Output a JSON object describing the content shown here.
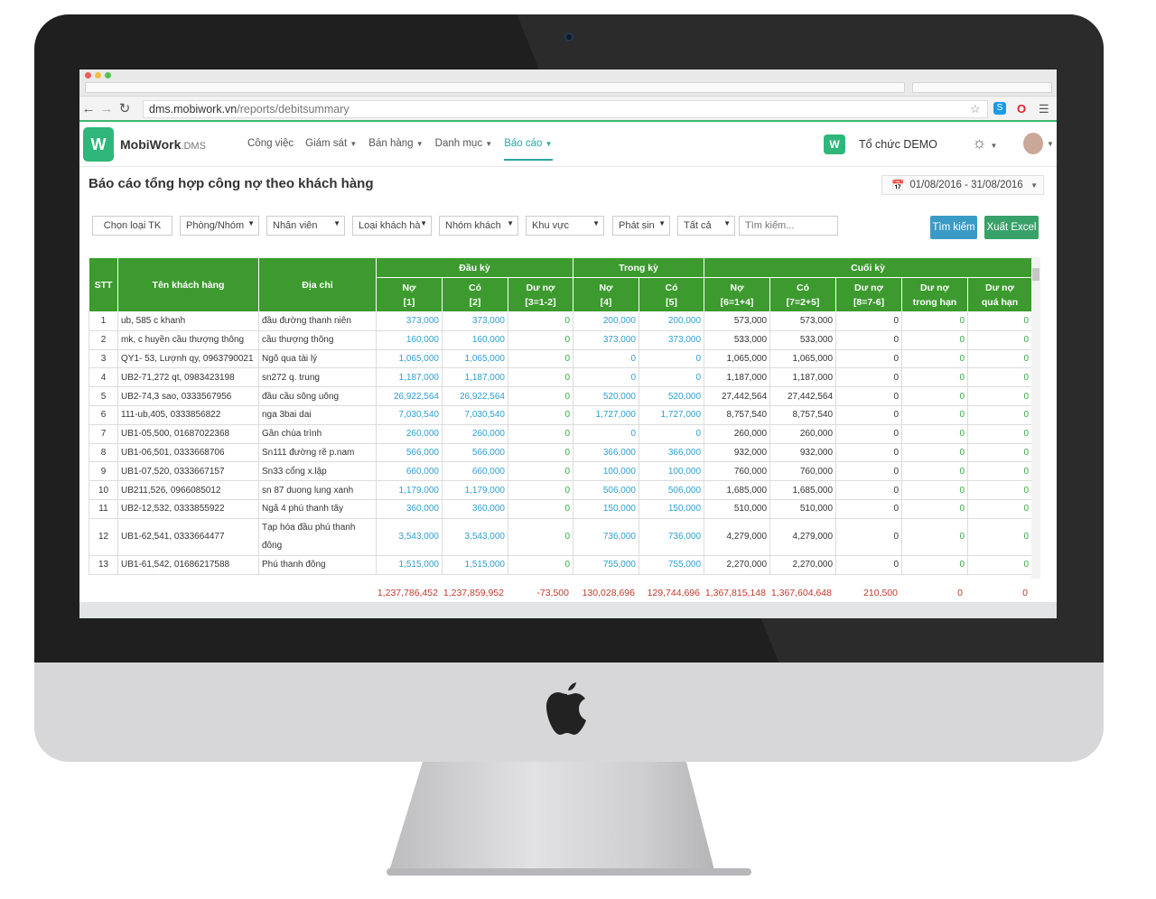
{
  "browser": {
    "url_host": "dms.mobiwork.vn",
    "url_path": "/reports/debitsummary"
  },
  "app": {
    "brand": "MobiWork",
    "brand_suffix": ".DMS",
    "logo_letter": "W",
    "menu": [
      "Công việc",
      "Giám sát",
      "Bán hàng",
      "Danh mục",
      "Báo cáo"
    ],
    "org_name": "Tổ chức DEMO"
  },
  "page": {
    "title": "Báo cáo tổng hợp công nợ theo khách hàng",
    "date_range": "01/08/2016 - 31/08/2016"
  },
  "filters": {
    "account_type": "Chọn loại TK",
    "department": "Phòng/Nhóm",
    "staff": "Nhân viên",
    "customer_type": "Loại khách hà",
    "customer_group": "Nhóm khách",
    "region": "Khu vực",
    "occurrence": "Phát sin",
    "status": "Tất cả",
    "search_placeholder": "Tìm kiếm...",
    "search_button": "Tìm kiếm",
    "export_button": "Xuất Excel"
  },
  "table": {
    "head": {
      "stt": "STT",
      "customer": "Tên khách hàng",
      "address": "Địa chỉ",
      "opening": "Đầu kỳ",
      "period": "Trong kỳ",
      "closing": "Cuối kỳ",
      "c1a": "Nợ",
      "c1b": "[1]",
      "c2a": "Có",
      "c2b": "[2]",
      "c3a": "Dư nợ",
      "c3b": "[3=1-2]",
      "c4a": "Nợ",
      "c4b": "[4]",
      "c5a": "Có",
      "c5b": "[5]",
      "c6a": "Nợ",
      "c6b": "[6=1+4]",
      "c7a": "Có",
      "c7b": "[7=2+5]",
      "c8a": "Dư nợ",
      "c8b": "[8=7-6]",
      "c9a": "Dư nợ",
      "c9b": "trong hạn",
      "c10a": "Dư nợ",
      "c10b": "quá hạn"
    },
    "rows": [
      [
        "1",
        "ub, 585 c khanh",
        "đầu đường thanh niên",
        "373,000",
        "373,000",
        "0",
        "200,000",
        "200,000",
        "573,000",
        "573,000",
        "0",
        "0",
        "0"
      ],
      [
        "2",
        "mk, c huyền cầu thượng thông",
        "cầu thượng thông",
        "160,000",
        "160,000",
        "0",
        "373,000",
        "373,000",
        "533,000",
        "533,000",
        "0",
        "0",
        "0"
      ],
      [
        "3",
        "QY1- 53, Lượnh qy, 0963790021",
        "Ngõ qua tài lý",
        "1,065,000",
        "1,065,000",
        "0",
        "0",
        "0",
        "1,065,000",
        "1,065,000",
        "0",
        "0",
        "0"
      ],
      [
        "4",
        "UB2-71,272 qt, 0983423198",
        "sn272 q. trung",
        "1,187,000",
        "1,187,000",
        "0",
        "0",
        "0",
        "1,187,000",
        "1,187,000",
        "0",
        "0",
        "0"
      ],
      [
        "5",
        "UB2-74,3 sao, 0333567956",
        "đầu cầu sông uông",
        "26,922,564",
        "26,922,564",
        "0",
        "520,000",
        "520,000",
        "27,442,564",
        "27,442,564",
        "0",
        "0",
        "0"
      ],
      [
        "6",
        "111-ub,405, 0333856822",
        "nga 3bai dai",
        "7,030,540",
        "7,030,540",
        "0",
        "1,727,000",
        "1,727,000",
        "8,757,540",
        "8,757,540",
        "0",
        "0",
        "0"
      ],
      [
        "7",
        "UB1-05,500, 01687022368",
        "Gần chùa trình",
        "260,000",
        "260,000",
        "0",
        "0",
        "0",
        "260,000",
        "260,000",
        "0",
        "0",
        "0"
      ],
      [
        "8",
        "UB1-06,501, 0333668706",
        "Sn111 đường rẽ p.nam",
        "566,000",
        "566,000",
        "0",
        "366,000",
        "366,000",
        "932,000",
        "932,000",
        "0",
        "0",
        "0"
      ],
      [
        "9",
        "UB1-07,520, 0333667157",
        "Sn33 cổng x.lập",
        "660,000",
        "660,000",
        "0",
        "100,000",
        "100,000",
        "760,000",
        "760,000",
        "0",
        "0",
        "0"
      ],
      [
        "10",
        "UB211,526, 0966085012",
        "sn 87 duong lung xanh",
        "1,179,000",
        "1,179,000",
        "0",
        "506,000",
        "506,000",
        "1,685,000",
        "1,685,000",
        "0",
        "0",
        "0"
      ],
      [
        "11",
        "UB2-12,532, 0333855922",
        "Ngã 4 phú thanh tây",
        "360,000",
        "360,000",
        "0",
        "150,000",
        "150,000",
        "510,000",
        "510,000",
        "0",
        "0",
        "0"
      ],
      [
        "12",
        "UB1-62,541, 0333664477",
        "Tạp hóa đầu phú thanh đông",
        "3,543,000",
        "3,543,000",
        "0",
        "736,000",
        "736,000",
        "4,279,000",
        "4,279,000",
        "0",
        "0",
        "0"
      ],
      [
        "13",
        "UB1-61,542, 01686217588",
        "Phú thanh đông",
        "1,515,000",
        "1,515,000",
        "0",
        "755,000",
        "755,000",
        "2,270,000",
        "2,270,000",
        "0",
        "0",
        "0"
      ]
    ],
    "totals": [
      "1,237,786,452",
      "1,237,859,952",
      "-73,500",
      "130,028,696",
      "129,744,696",
      "1,367,815,148",
      "1,367,604,648",
      "210,500",
      "0",
      "0"
    ]
  },
  "colors": {
    "header_green": "#3c9a2e",
    "accent_teal": "#2aa7a0",
    "value_blue": "#2e9fd1",
    "zero_green": "#3aa845",
    "total_red": "#c0392b"
  }
}
